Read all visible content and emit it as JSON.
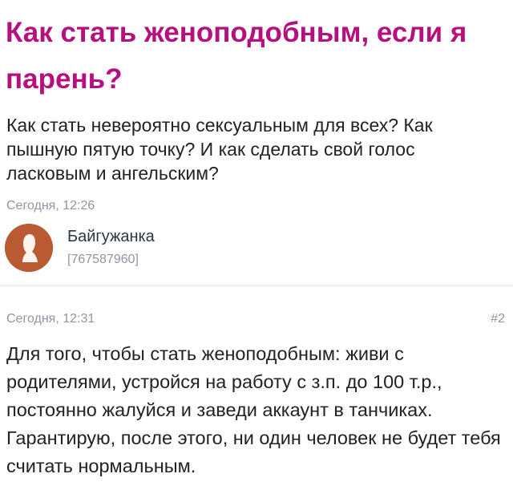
{
  "question": {
    "title": "Как стать женоподобным, если я парень?",
    "body": "Как стать невероятно сексуальным для всех? Как пышную пятую точку? И как сделать свой голос ласковым и ангельским?",
    "timestamp": "Сегодня, 12:26",
    "author": {
      "name": "Байгужанка",
      "id": "[767587960]",
      "avatar_color": "#b95a33",
      "avatar_icon": "user-silhouette-icon"
    }
  },
  "answer": {
    "timestamp": "Сегодня, 12:31",
    "number": "#2",
    "body": "Для того, чтобы стать женоподобным: живи с родителями, устройся на работу с з.п. до 100 т.р., постоянно жалуйся и заведи аккаунт в танчиках. Гарантирую, после этого, ни один человек не будет тебя считать нормальным."
  },
  "colors": {
    "title": "#b5107e",
    "meta": "#8e96a3",
    "text": "#222222"
  }
}
